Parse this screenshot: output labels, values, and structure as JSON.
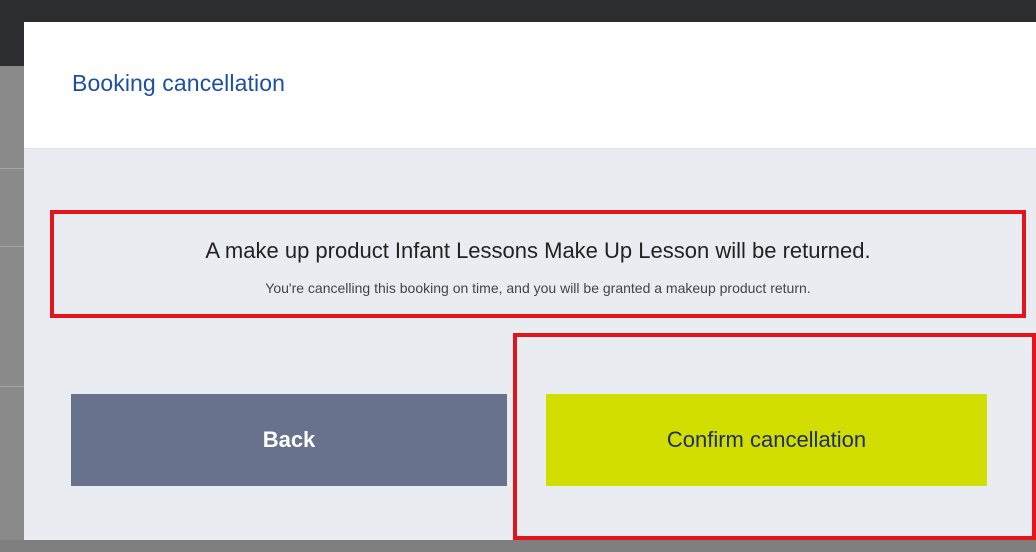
{
  "dialog": {
    "title": "Booking cancellation",
    "message": "A make up product Infant Lessons Make Up Lesson will be returned.",
    "submessage": "You're cancelling this booking on time, and you will be granted a makeup product return."
  },
  "buttons": {
    "back_label": "Back",
    "confirm_label": "Confirm cancellation"
  },
  "colors": {
    "title": "#1d4fa3",
    "back_button": "#68728d",
    "confirm_button": "#d2dd00",
    "highlight": "#e3141b"
  }
}
